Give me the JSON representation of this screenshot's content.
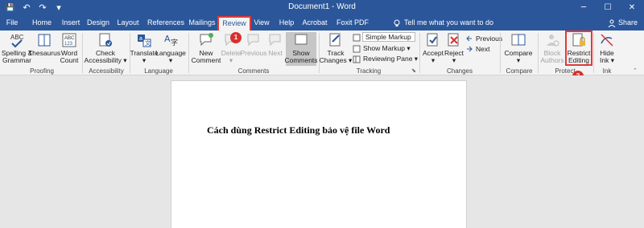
{
  "window": {
    "title": "Document1 - Word",
    "controls": [
      "─",
      "☐",
      "✕"
    ]
  },
  "qat": {
    "save": "💾",
    "undo": "↶",
    "redo": "↷",
    "customize": "▾"
  },
  "tabs": [
    "File",
    "Home",
    "Insert",
    "Design",
    "Layout",
    "References",
    "Mailings",
    "Review",
    "View",
    "Help",
    "Acrobat",
    "Foxit PDF"
  ],
  "active_tab": "Review",
  "tell_me": "Tell me what you want to do",
  "share": "Share",
  "ribbon": {
    "proofing": {
      "label": "Proofing",
      "spelling": "Spelling &\nGrammar",
      "thesaurus": "Thesaurus",
      "word_count": "Word\nCount"
    },
    "accessibility": {
      "label": "Accessibility",
      "check": "Check\nAccessibility ▾"
    },
    "language": {
      "label": "Language",
      "translate": "Translate\n▾",
      "language": "Language\n▾"
    },
    "comments": {
      "label": "Comments",
      "new": "New\nComment",
      "delete": "Delete\n▾",
      "previous": "Previous",
      "next": "Next",
      "show": "Show\nComments"
    },
    "tracking": {
      "label": "Tracking",
      "track": "Track\nChanges ▾",
      "markup_select": "Simple Markup",
      "show_markup": "Show Markup ▾",
      "reviewing_pane": "Reviewing Pane ▾"
    },
    "changes": {
      "label": "Changes",
      "accept": "Accept\n▾",
      "reject": "Reject\n▾",
      "previous": "Previous",
      "next": "Next"
    },
    "compare": {
      "label": "Compare",
      "compare": "Compare\n▾"
    },
    "protect": {
      "label": "Protect",
      "block": "Block\nAuthors",
      "restrict": "Restrict\nEditing"
    },
    "ink": {
      "label": "Ink",
      "hide": "Hide\nInk ▾"
    }
  },
  "annotations": {
    "step1": "1",
    "step2": "2"
  },
  "document": {
    "text": "Cách dùng Restrict Editing bảo vệ file Word"
  },
  "colors": {
    "brand": "#2b579a",
    "highlight": "#e03a3a",
    "ribbon_bg": "#f3f3f3",
    "canvas": "#e6e6e6"
  }
}
